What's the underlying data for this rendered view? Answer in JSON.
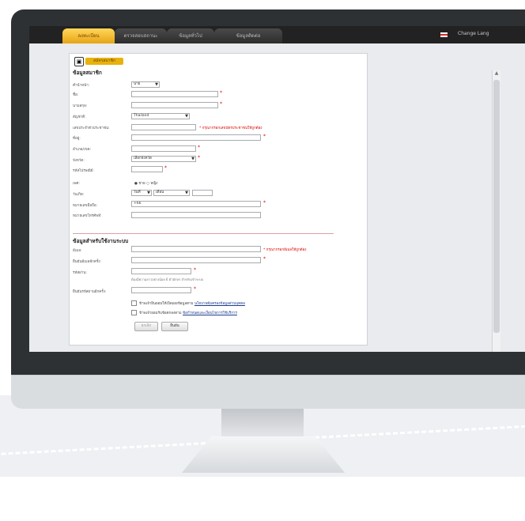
{
  "colors": {
    "accent": "#e7a416",
    "required": "#dd0000",
    "link": "#1a3d8f"
  },
  "nav": {
    "tabs": [
      {
        "label": "ลงทะเบียน"
      },
      {
        "label": "ตรวจสอบสถานะ"
      },
      {
        "label": "ข้อมูลทั่วไป"
      },
      {
        "label": "ข้อมูลติดต่อ"
      }
    ],
    "language": "Change Lang"
  },
  "form": {
    "badge": "สมัครสมาชิก",
    "section1_title": "ข้อมูลสมาชิก",
    "title_label": "คำนำหน้า:",
    "title_value": "นาย",
    "firstname_label": "ชื่อ:",
    "lastname_label": "นามสกุล:",
    "nationality_label": "สัญชาติ:",
    "nationality_value": "Thailand",
    "idcard_label": "เลขประจำตัวประชาชน:",
    "idcard_note": "* กรุณากรอกเลขบัตรประชาชนให้ถูกต้อง",
    "address_label": "ที่อยู่:",
    "district_label": "อำเภอ/เขต:",
    "province_label": "จังหวัด:",
    "province_value": "เลือกจังหวัด",
    "zip_label": "รหัสไปรษณีย์:",
    "gender_label": "เพศ:",
    "gender_options": "● ชาย  ○ หญิง",
    "birthday_label": "วันเกิด:",
    "day_value": "วันที่",
    "month_value": "เดือน",
    "mobile_label": "หมายเลขมือถือ:",
    "mobile_value": "+66",
    "phone_label": "หมายเลขโทรศัพท์:",
    "section2_title": "ข้อมูลสำหรับใช้งานระบบ",
    "email_label": "อีเมล:",
    "email_note": "* กรุณากรอกอีเมลให้ถูกต้อง",
    "email_confirm_label": "ยืนยันอีเมลอีกครั้ง:",
    "password_label": "รหัสผ่าน:",
    "password_help": "ต้องมีความยาวอย่างน้อย 6 ตัวอักษร สำหรับเข้าระบบ",
    "password_confirm_label": "ยืนยันรหัสผ่านอีกครั้ง:",
    "consent1_text": "ข้าพเจ้ายินยอมให้เปิดเผยข้อมูลตาม",
    "consent1_link": "นโยบายคุ้มครองข้อมูลส่วนบุคคล",
    "consent2_text": "ข้าพเจ้ายอมรับข้อตกลงตาม",
    "consent2_link": "ข้อกำหนดและเงื่อนไขการใช้บริการ",
    "reset_button": "ยกเลิก",
    "submit_button": "ยืนยัน",
    "required_mark": "*"
  }
}
